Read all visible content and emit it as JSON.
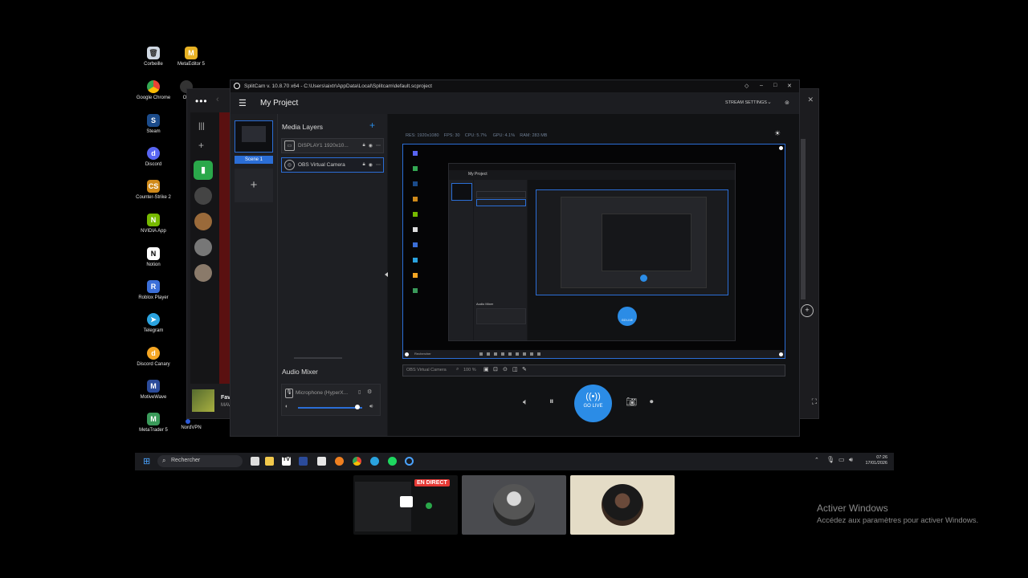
{
  "desktop": {
    "icons": [
      {
        "label": "Corbeille"
      },
      {
        "label": "MetaEditor 5"
      },
      {
        "label": "Google Chrome"
      },
      {
        "label": "Steam"
      },
      {
        "label": "Discord"
      },
      {
        "label": "Counter-Strike 2"
      },
      {
        "label": "NVIDIA App"
      },
      {
        "label": "Notion"
      },
      {
        "label": "Roblox Player"
      },
      {
        "label": "Telegram"
      },
      {
        "label": "Discord Canary"
      },
      {
        "label": "MotiveWave"
      },
      {
        "label": "MetaTrader 5"
      },
      {
        "label": "NordVPN"
      }
    ],
    "partial_labels": {
      "ob": "OB",
      "sp": "Sp"
    }
  },
  "background_window": {
    "now_playing_title": "Favo",
    "now_playing_sub": "MAV",
    "add_symbol": "⊕"
  },
  "splitcam": {
    "title": "SplitCam v. 10.8.70 x64 - C:\\Users\\aixtr\\AppData\\Local\\Splitcam\\default.scproject",
    "project_name": "My Project",
    "stream_settings": "STREAM SETTINGS",
    "scene_label": "Scene 1",
    "media_layers_title": "Media Layers",
    "layers": [
      {
        "name": "DISPLAY1 1920x10..."
      },
      {
        "name": "OBS Virtual Camera"
      }
    ],
    "audio_mixer_title": "Audio Mixer",
    "microphone_label": "Microphone (HyperX...",
    "stats": {
      "res": "RES: 1920x1080",
      "fps": "FPS: 30",
      "cpu": "CPU: 5.7%",
      "gpu": "GPU: 4.1%",
      "ram": "RAM: 283 MB"
    },
    "active_source": "OBS Virtual Camera",
    "zoom": "100 %",
    "go_live": "GO LIVE",
    "mic_volume": 0.92
  },
  "nested_preview": {
    "project_name": "My Project",
    "audio_mixer": "Audio Mixer",
    "go_live": "GO LIVE",
    "search": "Rechercher"
  },
  "taskbar": {
    "search_placeholder": "Rechercher",
    "time": "07:26",
    "date": "17/01/2026"
  },
  "call": {
    "live_badge": "EN DIRECT"
  },
  "watermark": {
    "title": "Activer Windows",
    "subtitle": "Accédez aux paramètres pour activer Windows."
  }
}
